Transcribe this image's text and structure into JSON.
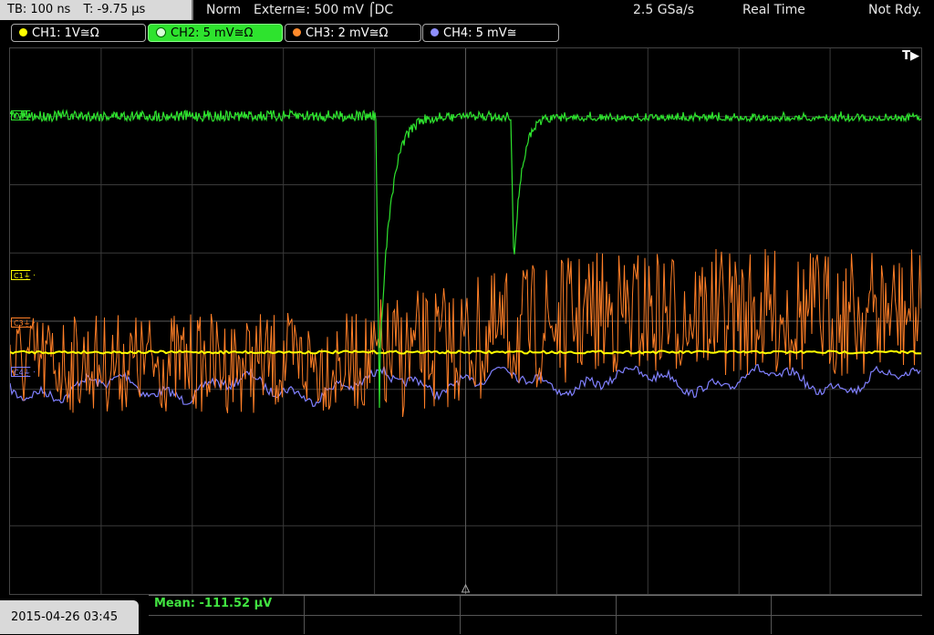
{
  "topbar": {
    "timebase": "TB: 100 ns",
    "trigger_time": "T: -9.75 µs",
    "mode": "Norm",
    "trigger_source": "Extern≅: 500 mV ⌠DC",
    "sample_rate": "2.5 GSa/s",
    "acquisition": "Real Time",
    "status": "Not Rdy."
  },
  "channels": [
    {
      "label": "CH1: 1V≅Ω",
      "color": "#ffff00",
      "active": false
    },
    {
      "label": "CH2: 5 mV≅Ω",
      "color": "#2ee32e",
      "active": true
    },
    {
      "label": "CH3: 2 mV≅Ω",
      "color": "#ff8a2b",
      "active": false
    },
    {
      "label": "CH4: 5 mV≅",
      "color": "#8f8fff",
      "active": false
    }
  ],
  "markers": {
    "c1": "C1⏚",
    "c2": "C2⏚",
    "c3": "C3⏚",
    "c4": "C4⏚",
    "trigger": "T▶"
  },
  "footer": {
    "datetime": "2015-04-26 03:45",
    "measurement": "Mean: -111.52 µV"
  },
  "colors": {
    "ch1": "#ffff00",
    "ch2": "#2ee32e",
    "ch3": "#ff7f27",
    "ch4": "#8080ff",
    "grid": "#3a3a3a"
  }
}
